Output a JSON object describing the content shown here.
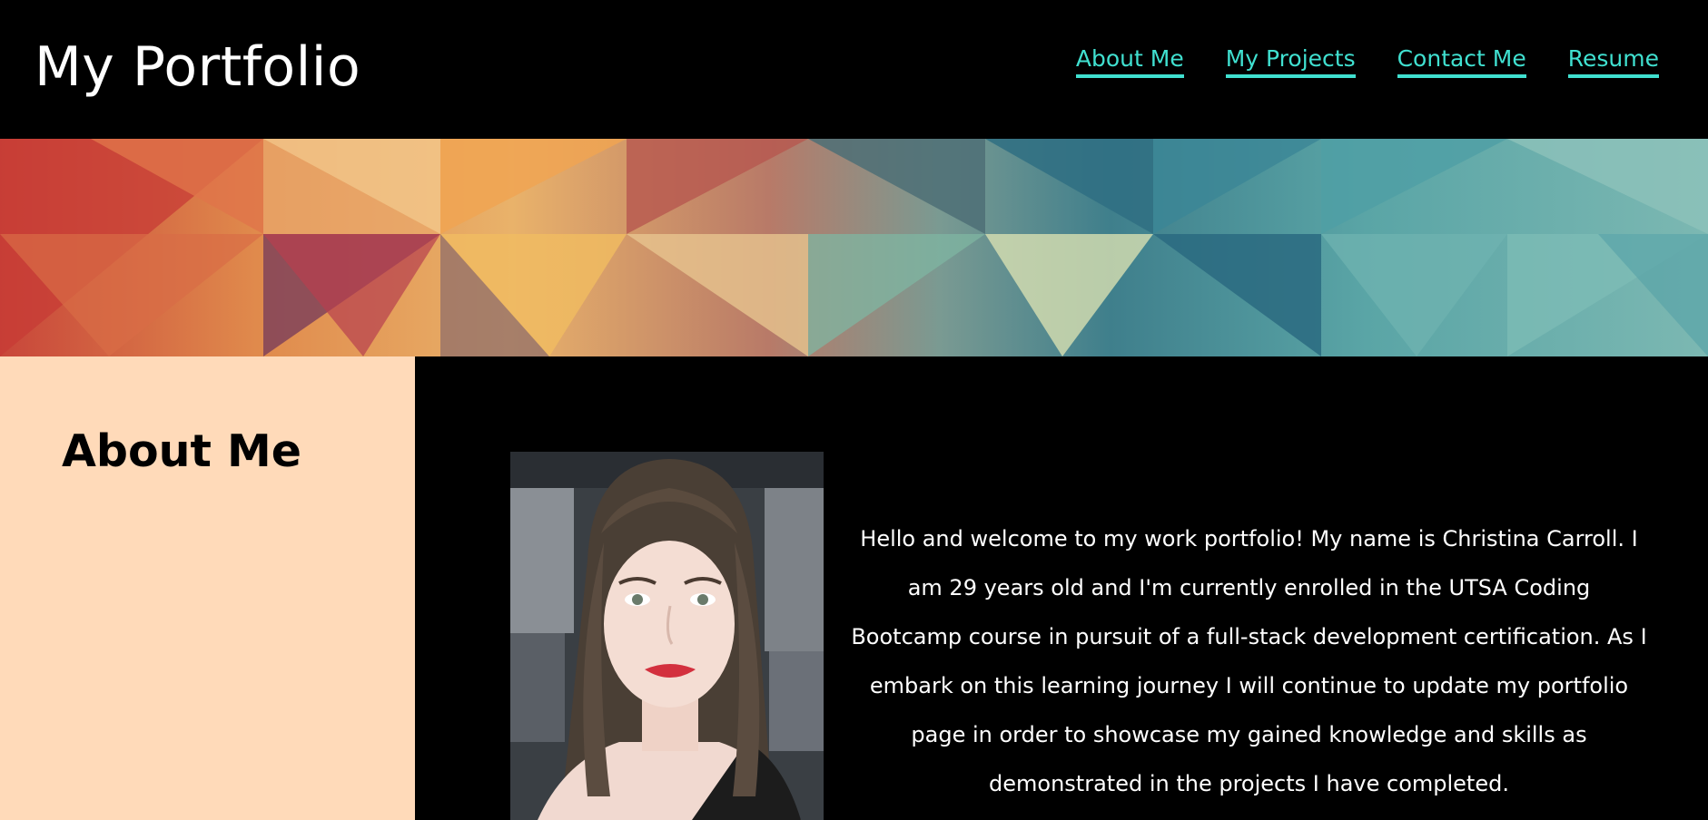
{
  "header": {
    "title": "My Portfolio",
    "nav": [
      {
        "label": "About Me"
      },
      {
        "label": "My Projects"
      },
      {
        "label": "Contact Me"
      },
      {
        "label": "Resume"
      }
    ]
  },
  "about": {
    "heading": "About Me",
    "bio": "Hello and welcome to my work portfolio! My name is Christina Carroll. I am 29 years old and I'm currently enrolled in the UTSA Coding Bootcamp course in pursuit of a full-stack development certification. As I embark on this learning journey I will continue to update my portfolio page in order to showcase my gained knowledge and skills as demonstrated in the projects I have completed."
  },
  "colors": {
    "background": "#000000",
    "nav_link": "#40e0d0",
    "sidebar": "#ffdab9",
    "heading": "#000000"
  }
}
